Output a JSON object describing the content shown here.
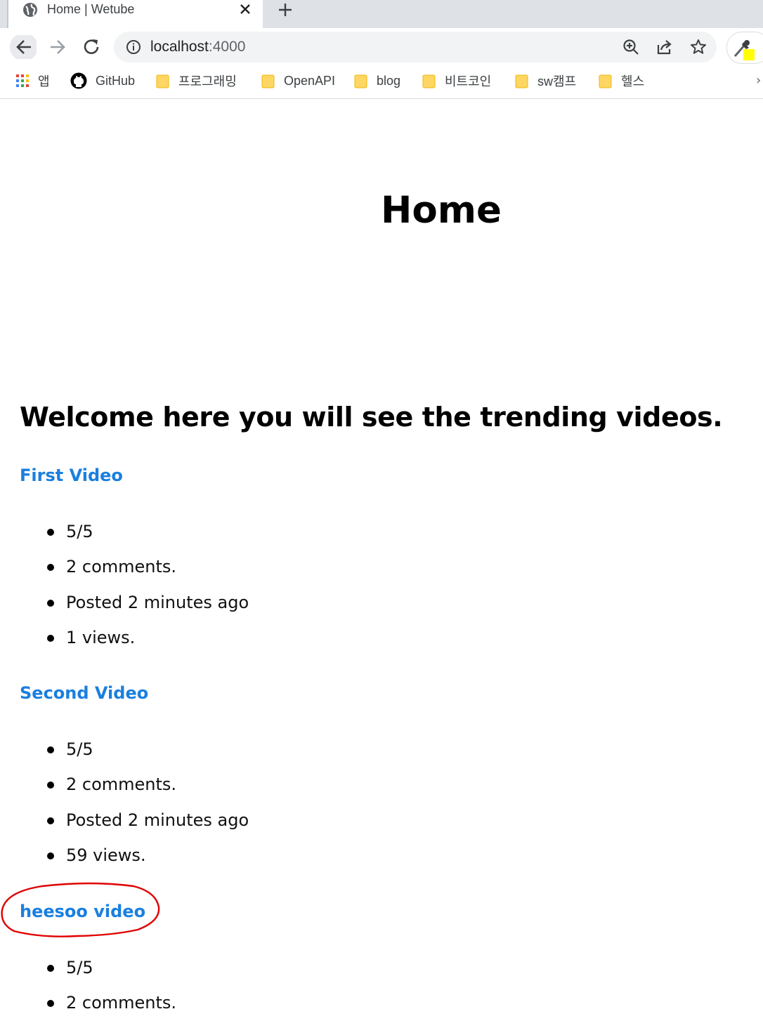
{
  "browser": {
    "tab_title": "Home | Wetube",
    "url_host": "localhost",
    "url_port": ":4000",
    "bookmarks": [
      {
        "label": "앱",
        "icon": "apps-grid-icon"
      },
      {
        "label": "GitHub",
        "icon": "github-icon"
      },
      {
        "label": "프로그래밍",
        "icon": "folder-icon"
      },
      {
        "label": "OpenAPI",
        "icon": "folder-icon"
      },
      {
        "label": "blog",
        "icon": "folder-icon"
      },
      {
        "label": "비트코인",
        "icon": "folder-icon"
      },
      {
        "label": "sw캠프",
        "icon": "folder-icon"
      },
      {
        "label": "헬스",
        "icon": "folder-icon"
      }
    ],
    "bookmarks_more": "›"
  },
  "page": {
    "title": "Home",
    "welcome": "Welcome here you will see the trending videos.",
    "videos": [
      {
        "title": "First Video",
        "rating": "5/5",
        "comments": "2 comments.",
        "posted": "Posted 2 minutes ago",
        "views": "1 views."
      },
      {
        "title": "Second Video",
        "rating": "5/5",
        "comments": "2 comments.",
        "posted": "Posted 2 minutes ago",
        "views": "59 views."
      },
      {
        "title": "heesoo video",
        "rating": "5/5",
        "comments": "2 comments."
      }
    ]
  },
  "colors": {
    "link": "#1a7fe0",
    "annotation": "#e00000"
  }
}
